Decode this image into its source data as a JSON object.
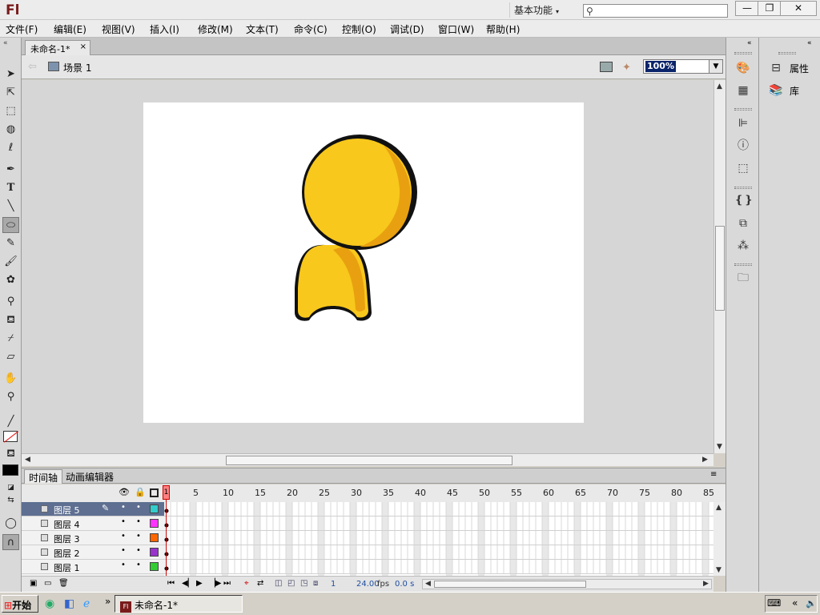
{
  "app": {
    "logo": "Fl",
    "workspace": "基本功能",
    "workspace_arrow": "▾"
  },
  "window_buttons": {
    "minimize": "—",
    "restore": "❐",
    "close": "✕"
  },
  "menu": [
    "文件(F)",
    "编辑(E)",
    "视图(V)",
    "插入(I)",
    "修改(M)",
    "文本(T)",
    "命令(C)",
    "控制(O)",
    "调试(D)",
    "窗口(W)",
    "帮助(H)"
  ],
  "document": {
    "tab": "未命名-1*",
    "close": "×",
    "scene": "场景 1",
    "zoom": "100%"
  },
  "timeline": {
    "tabs": [
      "时间轴",
      "动画编辑器"
    ],
    "frame_numbers": [
      "1",
      "5",
      "10",
      "15",
      "20",
      "25",
      "30",
      "35",
      "40",
      "45",
      "50",
      "55",
      "60",
      "65",
      "70",
      "75",
      "80",
      "85"
    ],
    "layers": [
      {
        "name": "图层 5",
        "color": "#33cccc",
        "selected": true
      },
      {
        "name": "图层 4",
        "color": "#ff33ff",
        "selected": false
      },
      {
        "name": "图层 3",
        "color": "#ff6600",
        "selected": false
      },
      {
        "name": "图层 2",
        "color": "#9933cc",
        "selected": false
      },
      {
        "name": "图层 1",
        "color": "#33cc33",
        "selected": false
      }
    ],
    "current_frame": "1",
    "fps": "24.00",
    "fps_unit": "fps",
    "time": "0.0 s"
  },
  "right_panel": {
    "properties": "属性",
    "library": "库"
  },
  "taskbar": {
    "start": "开始",
    "task": "未命名-1*",
    "more": "»",
    "tray_arrows": "«"
  },
  "character": {
    "fill": "#f8c81c",
    "shade": "#e8a010",
    "outline": "#111111"
  }
}
